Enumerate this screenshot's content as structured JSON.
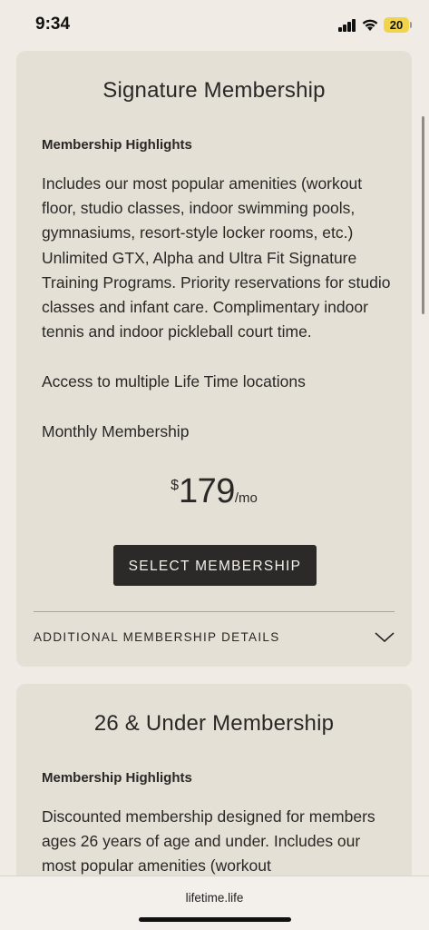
{
  "status_bar": {
    "time": "9:34",
    "battery_level": "20",
    "battery_color": "#f2d44a"
  },
  "cards": [
    {
      "title": "Signature Membership",
      "highlights_label": "Membership Highlights",
      "description": "Includes our most popular amenities (workout floor, studio classes, indoor swimming pools, gymnasiums, resort-style locker rooms, etc.) Unlimited GTX, Alpha and Ultra Fit Signature Training Programs. Priority reservations for studio classes and infant care. Complimentary indoor tennis and indoor pickleball court time.",
      "access": "Access to multiple Life Time locations",
      "membership_type": "Monthly Membership",
      "price": {
        "currency": "$",
        "amount": "179",
        "unit": "/mo"
      },
      "select_button": "SELECT MEMBERSHIP",
      "details_label": "ADDITIONAL MEMBERSHIP DETAILS"
    },
    {
      "title": "26 & Under Membership",
      "highlights_label": "Membership Highlights",
      "description": "Discounted membership designed for members ages 26 years of age and under. Includes our most popular amenities (workout"
    }
  ],
  "browser": {
    "url": "lifetime.life"
  },
  "colors": {
    "page_background": "#f0ebe4",
    "card_background": "#e5e0d6",
    "button_background": "#2b2a28",
    "button_text": "#f2efe9"
  }
}
